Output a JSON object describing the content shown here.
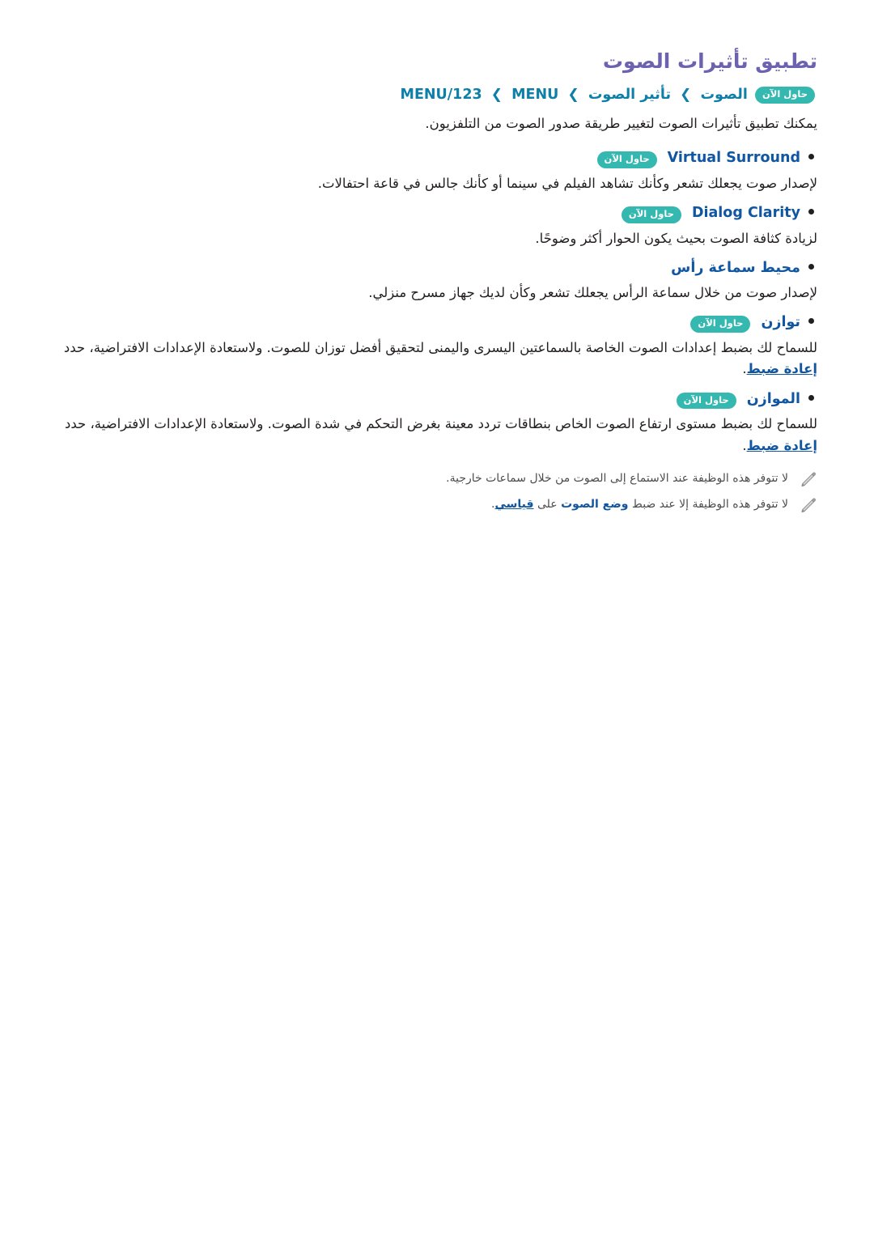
{
  "page": {
    "title": "تطبيق تأثيرات الصوت",
    "title_color": "#6b62b0",
    "accent_badge_color": "#35b8b0",
    "breadcrumb_color": "#0d7fa8",
    "link_color": "#1156a0"
  },
  "breadcrumb": {
    "items": [
      "MENU/123",
      "MENU",
      "الصوت",
      "تأثير الصوت"
    ],
    "separator": "❮",
    "badge": "حاول الآن"
  },
  "intro": {
    "text": "يمكنك تطبيق تأثيرات الصوت لتغيير طريقة صدور الصوت من التلفزيون."
  },
  "bullets": [
    {
      "title": "Virtual Surround",
      "script": "latin",
      "badge": "حاول الآن",
      "desc": "لإصدار صوت يجعلك تشعر وكأنك تشاهد الفيلم في سينما أو كأنك جالس في قاعة احتفالات."
    },
    {
      "title": "Dialog Clarity",
      "script": "latin",
      "badge": "حاول الآن",
      "desc": "لزيادة كثافة الصوت بحيث يكون الحوار أكثر وضوحًا."
    },
    {
      "title": "محيط سماعة رأس",
      "script": "arabic",
      "badge": "",
      "desc": "لإصدار صوت من خلال سماعة الرأس يجعلك تشعر وكأن لديك جهاز مسرح منزلي."
    },
    {
      "title": "توازن",
      "script": "arabic",
      "badge": "حاول الآن",
      "desc_before": "للسماح لك بضبط إعدادات الصوت الخاصة بالسماعتين اليسرى واليمنى لتحقيق أفضل توزان للصوت. ولاستعادة الإعدادات الافتراضية، حدد ",
      "desc_link": "إعادة ضبط",
      "desc_after": "."
    },
    {
      "title": "الموازن",
      "script": "arabic",
      "badge": "حاول الآن",
      "desc_before": "للسماح لك بضبط مستوى ارتفاع الصوت الخاص بنطاقات تردد معينة بغرض التحكم في شدة الصوت. ولاستعادة الإعدادات الافتراضية، حدد ",
      "desc_link": "إعادة ضبط",
      "desc_after": "."
    }
  ],
  "notes": [
    {
      "icon": "pencil-icon",
      "text": "لا تتوفر هذه الوظيفة عند الاستماع إلى الصوت من خلال سماعات خارجية."
    },
    {
      "icon": "pencil-icon",
      "text_before": "لا تتوفر هذه الوظيفة إلا عند ضبط ",
      "text_link": "وضع الصوت",
      "text_mid": " على ",
      "text_link2": "قياسي",
      "text_after": "."
    }
  ]
}
